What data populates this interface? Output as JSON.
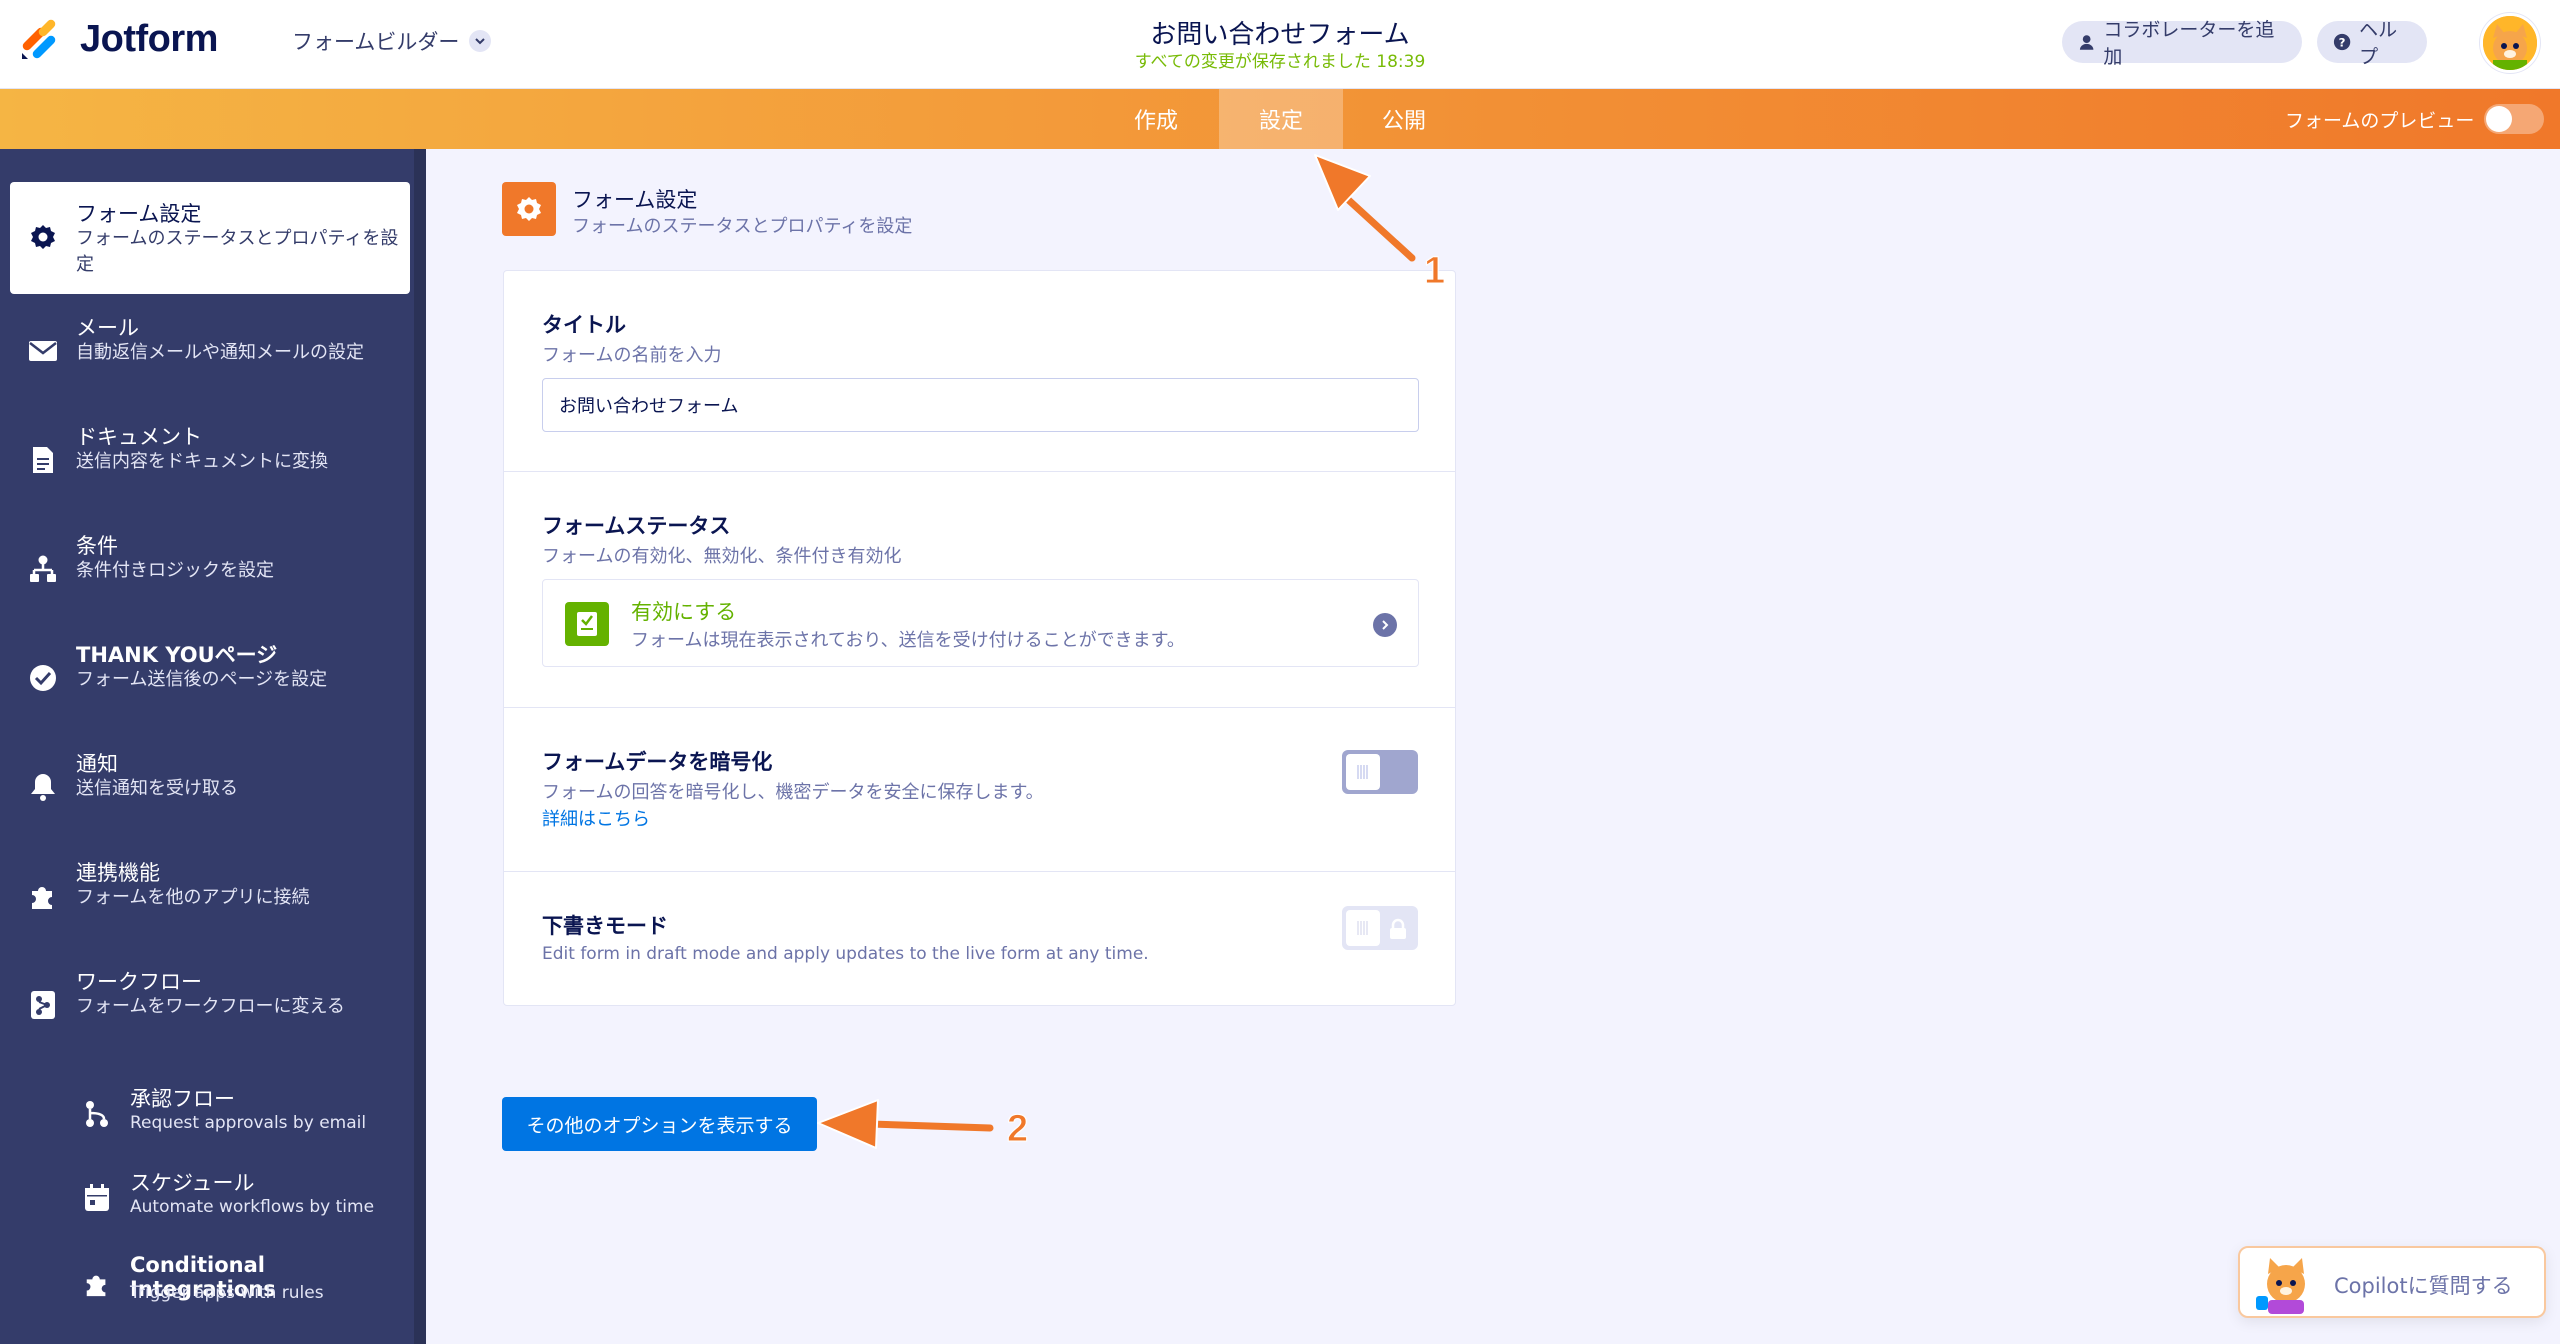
{
  "header": {
    "brand": "Jotform",
    "builder_label": "フォームビルダー",
    "form_title": "お問い合わせフォーム",
    "saved_status": "すべての変更が保存されました 18:39",
    "collab_label": "コラボレーターを追加",
    "help_label": "ヘルプ"
  },
  "nav": {
    "tabs": [
      {
        "label": "作成"
      },
      {
        "label": "設定"
      },
      {
        "label": "公開"
      }
    ],
    "active_tab": "設定",
    "preview_label": "フォームのプレビュー",
    "preview_on": false
  },
  "sidebar": {
    "items": [
      {
        "title": "フォーム設定",
        "desc": "フォームのステータスとプロパティを設定",
        "icon": "gear-icon"
      },
      {
        "title": "メール",
        "desc": "自動返信メールや通知メールの設定",
        "icon": "envelope-icon"
      },
      {
        "title": "ドキュメント",
        "desc": "送信内容をドキュメントに変換",
        "icon": "document-icon"
      },
      {
        "title": "条件",
        "desc": "条件付きロジックを設定",
        "icon": "hierarchy-icon"
      },
      {
        "title": "THANK YOUページ",
        "desc": "フォーム送信後のページを設定",
        "icon": "check-circle-icon"
      },
      {
        "title": "通知",
        "desc": "送信通知を受け取る",
        "icon": "bell-icon"
      },
      {
        "title": "連携機能",
        "desc": "フォームを他のアプリに接続",
        "icon": "puzzle-icon"
      },
      {
        "title": "ワークフロー",
        "desc": "フォームをワークフローに変える",
        "icon": "workflow-icon"
      }
    ],
    "sub_items": [
      {
        "title": "承認フロー",
        "desc": "Request approvals by email",
        "icon": "approval-flow-icon"
      },
      {
        "title": "スケジュール",
        "desc": "Automate workflows by time",
        "icon": "calendar-icon"
      },
      {
        "title": "Conditional Integrations",
        "desc": "Trigger apps with rules",
        "icon": "puzzle-icon"
      }
    ]
  },
  "main": {
    "section_title": "フォーム設定",
    "section_sub": "フォームのステータスとプロパティを設定",
    "title_label": "タイトル",
    "title_hint": "フォームの名前を入力",
    "title_value": "お問い合わせフォーム",
    "status_label": "フォームステータス",
    "status_hint": "フォームの有効化、無効化、条件付き有効化",
    "status_option_title": "有効にする",
    "status_option_desc": "フォームは現在表示されており、送信を受け付けることができます。",
    "encrypt_label": "フォームデータを暗号化",
    "encrypt_hint": "フォームの回答を暗号化し、機密データを安全に保存します。",
    "encrypt_link": "詳細はこちら",
    "encrypt_on": false,
    "draft_label": "下書きモード",
    "draft_hint": "Edit form in draft mode and apply updates to the live form at any time.",
    "draft_on": false,
    "more_options_label": "その他のオプションを表示する"
  },
  "annotations": {
    "marker_1": "1",
    "marker_2": "2"
  },
  "copilot": {
    "label": "Copilotに質問する"
  },
  "colors": {
    "brand_orange": "#f0782a",
    "sidebar_bg": "#343c6a",
    "primary_blue": "#0075e3",
    "success_green": "#64b200"
  }
}
